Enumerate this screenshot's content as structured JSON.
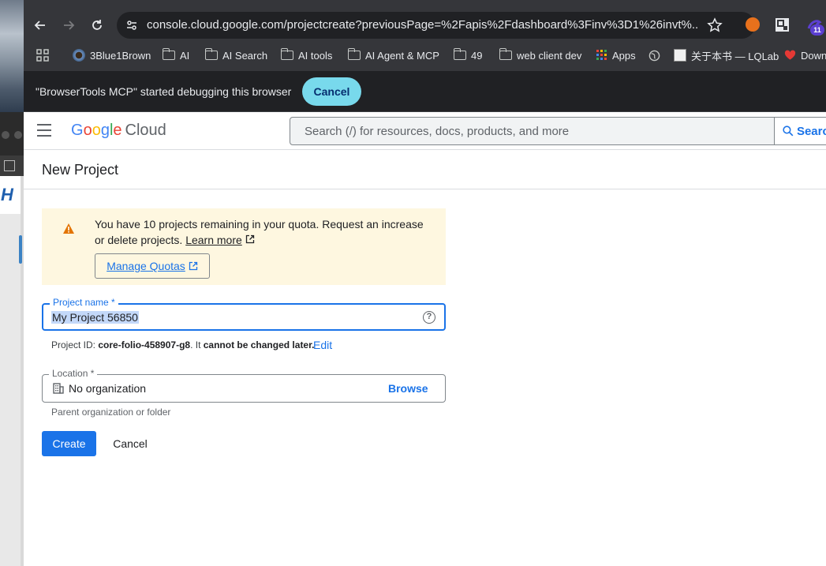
{
  "browser": {
    "url": "console.cloud.google.com/projectcreate?previousPage=%2Fapis%2Fdashboard%3Finv%3D1%26invt%...",
    "extension_badge": "11",
    "bookmarks": [
      {
        "label": "3Blue1Brown",
        "icon": "3b1b-icon"
      },
      {
        "label": "AI",
        "icon": "folder-icon"
      },
      {
        "label": "AI Search",
        "icon": "folder-icon"
      },
      {
        "label": "AI tools",
        "icon": "folder-icon"
      },
      {
        "label": "AI Agent & MCP",
        "icon": "folder-icon"
      },
      {
        "label": "49",
        "icon": "folder-icon"
      },
      {
        "label": "web client dev",
        "icon": "folder-icon"
      },
      {
        "label": "Apps",
        "icon": "apps-grid-icon"
      },
      {
        "label": "",
        "icon": "globe-icon"
      },
      {
        "label": "关于本书 — LQLab",
        "icon": "avatar-icon"
      },
      {
        "label": "Down",
        "icon": "heart-icon"
      }
    ]
  },
  "infobar": {
    "message": "\"BrowserTools MCP\" started debugging this browser",
    "cancel_label": "Cancel"
  },
  "header": {
    "logo_g1": "G",
    "logo_o1": "o",
    "logo_o2": "o",
    "logo_g2": "g",
    "logo_l": "l",
    "logo_e": "e",
    "logo_cloud": "Cloud",
    "search_placeholder": "Search (/) for resources, docs, products, and more",
    "search_button": "Search"
  },
  "page": {
    "title": "New Project"
  },
  "quota": {
    "text": "You have 10 projects remaining in your quota. Request an increase or delete projects.",
    "learn_more": "Learn more",
    "manage_quotas": "Manage Quotas"
  },
  "form": {
    "project_name_label": "Project name *",
    "project_name_value": "My Project 56850",
    "project_id_prefix": "Project ID: ",
    "project_id_value": "core-folio-458907-g8",
    "project_id_suffix_plain": ". It ",
    "project_id_suffix_bold": "cannot be changed later.",
    "edit_label": "Edit",
    "location_label": "Location *",
    "location_value": "No organization",
    "browse_label": "Browse",
    "location_hint": "Parent organization or folder",
    "create_label": "Create",
    "cancel_label": "Cancel"
  },
  "colors": {
    "accent": "#1a73e8",
    "warning_bg": "#fef7e0",
    "warning_icon": "#e37400",
    "infobar_button": "#78d9ec"
  }
}
